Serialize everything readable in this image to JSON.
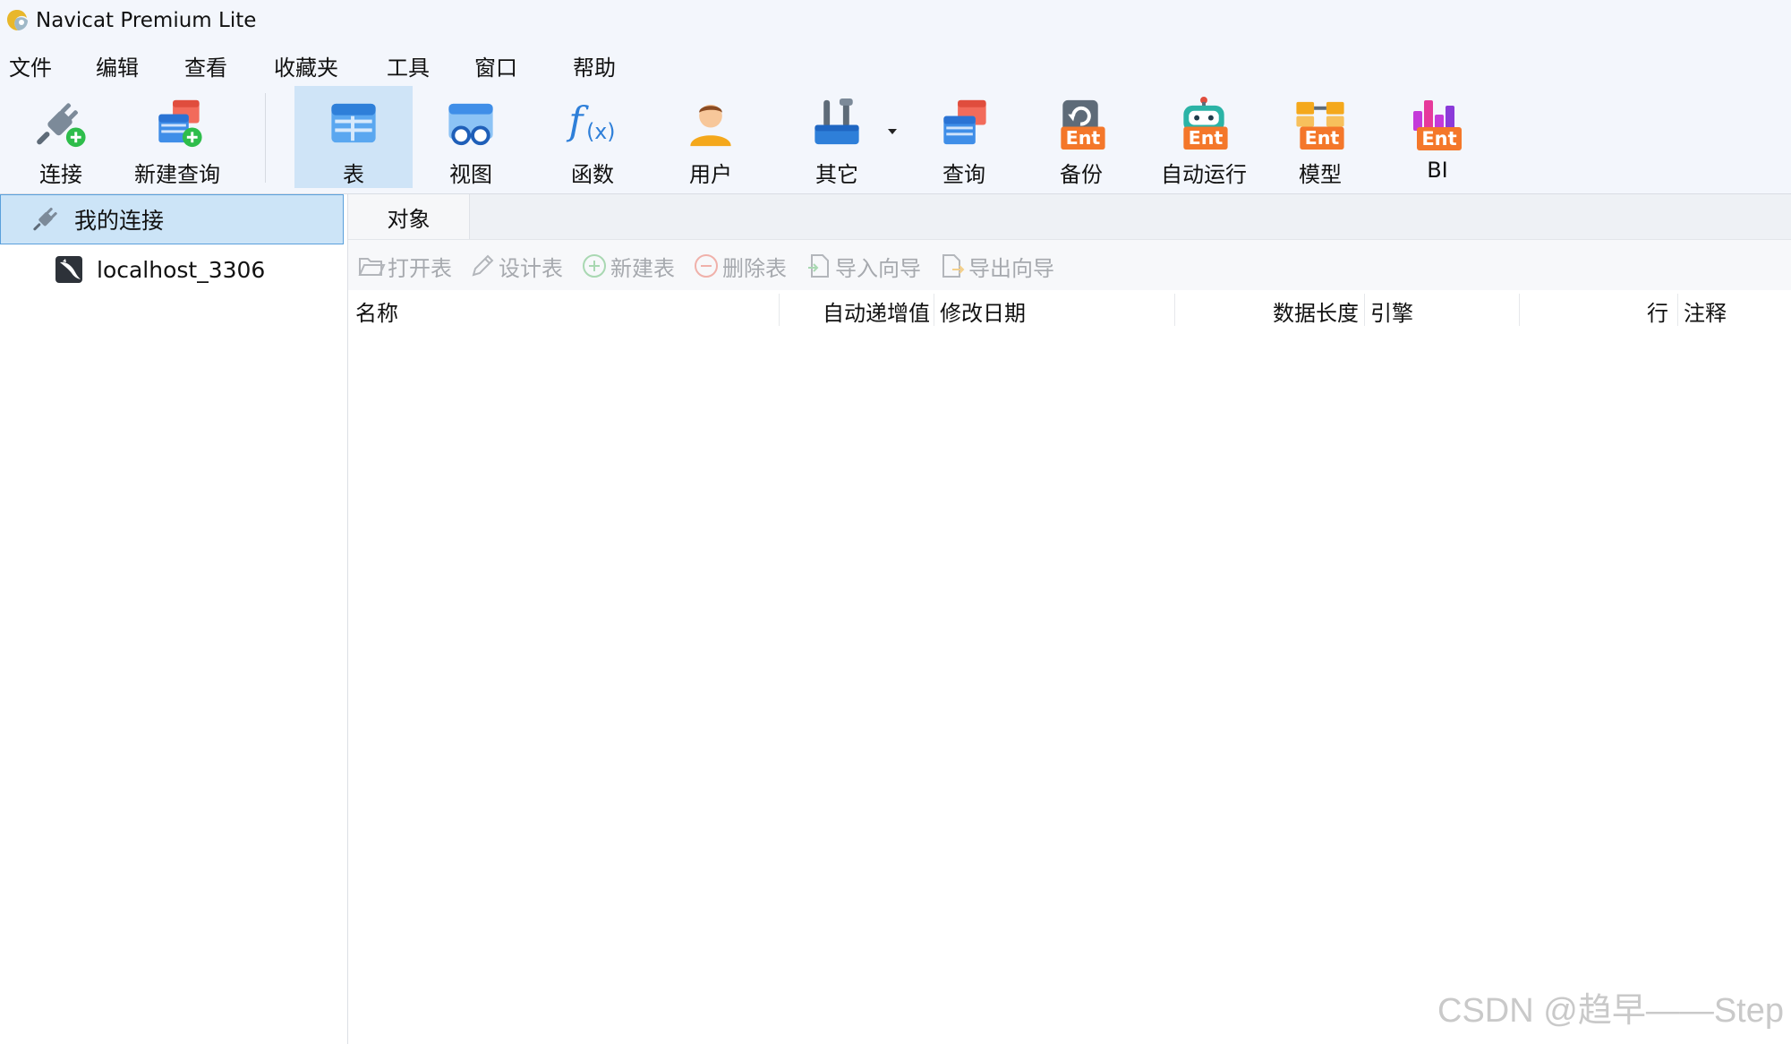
{
  "window": {
    "title": "Navicat Premium Lite"
  },
  "menu": [
    "文件",
    "编辑",
    "查看",
    "收藏夹",
    "工具",
    "窗口",
    "帮助"
  ],
  "toolbar": {
    "connect": "连接",
    "new_query": "新建查询",
    "table": "表",
    "view": "视图",
    "function": "函数",
    "user": "用户",
    "other": "其它",
    "query": "查询",
    "backup": "备份",
    "automation": "自动运行",
    "model": "模型",
    "bi": "BI",
    "ent_badge": "Ent"
  },
  "nav": {
    "group": "我的连接",
    "connection": "localhost_3306"
  },
  "tabs": {
    "objects": "对象"
  },
  "actions": {
    "open_table": "打开表",
    "design_table": "设计表",
    "new_table": "新建表",
    "delete_table": "删除表",
    "import_wizard": "导入向导",
    "export_wizard": "导出向导"
  },
  "columns": {
    "name": "名称",
    "auto_inc": "自动递增值",
    "modified": "修改日期",
    "data_length": "数据长度",
    "engine": "引擎",
    "rows": "行",
    "comment": "注释"
  },
  "watermark": "CSDN @趋早——Step",
  "colors": {
    "accent": "#cce4f7",
    "selected_border": "#5aa0dc",
    "disabled_text": "#a6a9ae",
    "ent_orange": "#f4772a"
  }
}
